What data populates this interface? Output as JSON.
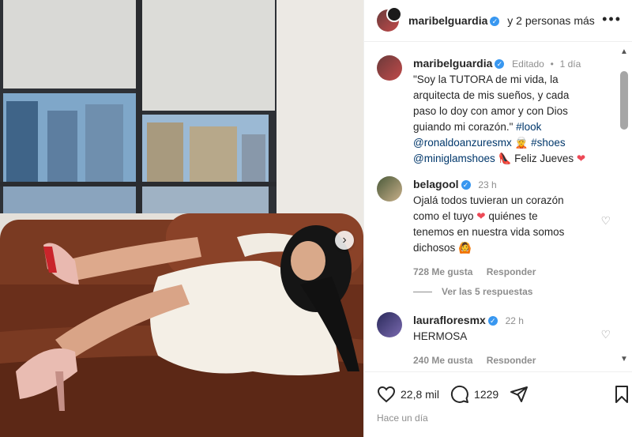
{
  "header": {
    "username": "maribelguardia",
    "collab_text": "y 2 personas más"
  },
  "caption": {
    "username": "maribelguardia",
    "edited": "Editado",
    "time": "1 día",
    "line1": "\"Soy la TUTORA  de mi vida, la",
    "line2": "arquitecta de mis sueños, y cada",
    "line3": "paso lo doy con amor y con Dios",
    "line4a": "guiando mi corazón.\" ",
    "hashtag_look": "#look",
    "mention1": "@ronaldoanzuresmx",
    "hashtag_shoes": "#shoes",
    "mention2": "@miniglamshoes",
    "feliz": "Feliz Jueves"
  },
  "comments": [
    {
      "username": "belagool",
      "time": "23 h",
      "line1": "Ojalá todos tuvieran un corazón",
      "line2a": "como el tuyo ",
      "line2b": " quiénes te",
      "line3": "tenemos en nuestra vida somos",
      "line4": "dichosos",
      "likes": "728 Me gusta",
      "reply": "Responder",
      "view_replies": "Ver las 5 respuestas"
    },
    {
      "username": "laurafloresmx",
      "time": "22 h",
      "text": "HERMOSA",
      "likes": "240 Me gusta",
      "reply": "Responder"
    }
  ],
  "actions": {
    "like_count": "22,8 mil",
    "comment_count": "1229"
  },
  "footer": {
    "posted": "Hace un día"
  },
  "colors": {
    "link": "#00376b",
    "verified": "#3897f0",
    "heart": "#ed4956"
  }
}
